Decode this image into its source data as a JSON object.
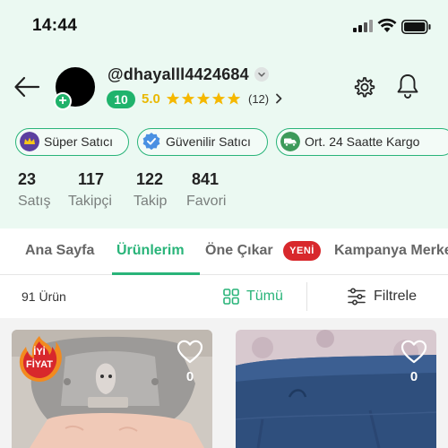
{
  "status_bar": {
    "time": "14:44"
  },
  "profile": {
    "username": "@dhayalll4424684",
    "level": "10",
    "rating": "5.0",
    "stars": 5,
    "review_count": "(12)"
  },
  "badges": [
    {
      "label": "Süper Satıcı",
      "icon": "crown-icon",
      "color": "#5b3fa0"
    },
    {
      "label": "Güvenilir Satıcı",
      "icon": "verified-check-icon",
      "color": "#4a90e2"
    },
    {
      "label": "Ort. 24 Saatte Kargo",
      "icon": "cargo-truck-icon",
      "color": "#3d9a5a"
    }
  ],
  "stats": [
    {
      "value": "23",
      "label": "Satış"
    },
    {
      "value": "117",
      "label": "Takipçi"
    },
    {
      "value": "122",
      "label": "Takip"
    },
    {
      "value": "841",
      "label": "Favori"
    }
  ],
  "tabs": [
    {
      "label": "Ana Sayfa",
      "active": false
    },
    {
      "label": "Ürünlerim",
      "active": true
    },
    {
      "label": "Öne Çıkar",
      "active": false
    },
    {
      "label": "Kampanya Merkezi",
      "active": false
    }
  ],
  "new_badge": "YENİ",
  "filter_bar": {
    "product_count": "91 Ürün",
    "all_label": "Tümü",
    "filter_label": "Filtrele"
  },
  "products": [
    {
      "likes": "0",
      "good_price_label_1": "İYİ",
      "good_price_label_2": "FİYAT"
    },
    {
      "likes": "0"
    }
  ],
  "colors": {
    "accent_green": "#29b479",
    "header_bg": "#ebf9f2",
    "star_yellow": "#f5b800",
    "new_red": "#d8282c"
  }
}
